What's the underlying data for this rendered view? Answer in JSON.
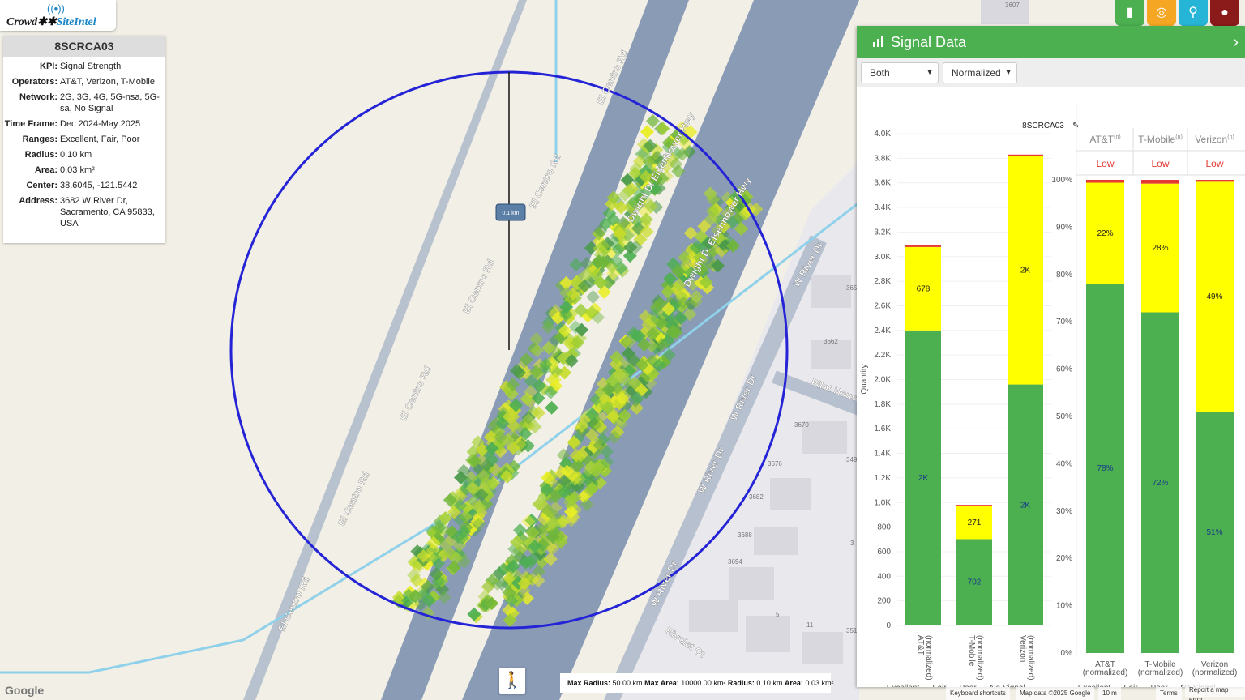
{
  "logo": {
    "text_a": "Crowd",
    "text_b": "SiteIntel"
  },
  "site_panel": {
    "title": "8SCRCA03",
    "rows": [
      {
        "k": "KPI:",
        "v": "Signal Strength"
      },
      {
        "k": "Operators:",
        "v": "AT&T, Verizon, T-Mobile"
      },
      {
        "k": "Network:",
        "v": "2G, 3G, 4G, 5G-nsa, 5G-sa, No Signal"
      },
      {
        "k": "Time Frame:",
        "v": "Dec 2024-May 2025"
      },
      {
        "k": "Ranges:",
        "v": "Excellent, Fair, Poor"
      },
      {
        "k": "Radius:",
        "v": "0.10 km"
      },
      {
        "k": "Area:",
        "v": "0.03 km²"
      },
      {
        "k": "Center:",
        "v": "38.6045, -121.5442"
      },
      {
        "k": "Address:",
        "v": "3682 W River Dr, Sacramento, CA 95833, USA"
      }
    ]
  },
  "map": {
    "radius_label": "0.1 km",
    "roads": [
      "El Centro Rd",
      "El Centro Rd",
      "El Centro Rd",
      "El Centro Rd",
      "El Centro Rd",
      "El Centro Rd",
      "Dwight D. Eisenhower Hwy",
      "Dwight D. Eisenhower Hwy",
      "W River Dr",
      "W River Dr",
      "W River Dr",
      "W River Dr",
      "Pilot House",
      "Rivulet Ct"
    ],
    "addresses": [
      "3607",
      "3662",
      "3670",
      "3676",
      "3682",
      "3688",
      "3694",
      "5",
      "11",
      "365",
      "349",
      "351",
      "3"
    ],
    "stats": {
      "max_radius_label": "Max Radius:",
      "max_radius": "50.00 km",
      "max_area_label": "Max Area:",
      "max_area": "10000.00 km²",
      "radius_label": "Radius:",
      "radius": "0.10 km",
      "area_label": "Area:",
      "area": "0.03 km²"
    },
    "attribution": {
      "google": "Google",
      "keyboard": "Keyboard shortcuts",
      "mapdata": "Map data ©2025 Google",
      "scale": "10 m",
      "terms": "Terms",
      "report": "Report a map error"
    }
  },
  "toolbar": {
    "buttons": [
      {
        "name": "signal-chart",
        "color": "#4caf50"
      },
      {
        "name": "target",
        "color": "#f5a623"
      },
      {
        "name": "location-pin",
        "color": "#26b5d6"
      },
      {
        "name": "globe",
        "color": "#8b1a1a"
      }
    ]
  },
  "signal_panel": {
    "title": "Signal Data",
    "filter_operator": "Both",
    "filter_mode": "Normalized",
    "site_label": "8SCRCA03"
  },
  "colors": {
    "excellent": "#4caf50",
    "fair": "#ffff00",
    "poor": "#e53935",
    "no_signal": "#bdbdbd",
    "circle": "#2424d6"
  },
  "chart_data": [
    {
      "type": "bar",
      "stacked": true,
      "title": "8SCRCA03",
      "ylabel": "Quantity",
      "ylim": [
        0,
        4000
      ],
      "yticks": [
        "0",
        "200",
        "400",
        "600",
        "800",
        "1.0K",
        "1.2K",
        "1.4K",
        "1.6K",
        "1.8K",
        "2.0K",
        "2.2K",
        "2.4K",
        "2.6K",
        "2.8K",
        "3.0K",
        "3.2K",
        "3.4K",
        "3.6K",
        "3.8K",
        "4.0K"
      ],
      "categories": [
        "AT&T (normalized)",
        "T-Mobile (normalized)",
        "Verizon (normalized)"
      ],
      "series": [
        {
          "name": "Excellent",
          "values": [
            2400,
            702,
            1960
          ],
          "labels": [
            "2K",
            "702",
            "2K"
          ]
        },
        {
          "name": "Fair",
          "values": [
            678,
            271,
            1860
          ],
          "labels": [
            "678",
            "271",
            "2K"
          ]
        },
        {
          "name": "Poor",
          "values": [
            18,
            8,
            10
          ],
          "labels": [
            "",
            "",
            ""
          ]
        },
        {
          "name": "No Signal",
          "values": [
            0,
            0,
            0
          ],
          "labels": [
            "",
            "",
            ""
          ]
        }
      ],
      "legend": [
        "Excellent",
        "Fair",
        "Poor",
        "No Signal"
      ]
    },
    {
      "type": "bar",
      "stacked": true,
      "ylim": [
        0,
        100
      ],
      "yticks": [
        "0%",
        "10%",
        "20%",
        "30%",
        "40%",
        "50%",
        "60%",
        "70%",
        "80%",
        "90%",
        "100%"
      ],
      "headers": [
        "AT&T",
        "T-Mobile",
        "Verizon"
      ],
      "header_sup": "(n)",
      "ratings": [
        "Low",
        "Low",
        "Low"
      ],
      "categories": [
        "AT&T (normalized)",
        "T-Mobile (normalized)",
        "Verizon (normalized)"
      ],
      "series": [
        {
          "name": "Excellent",
          "values": [
            78,
            72,
            51
          ],
          "labels": [
            "78%",
            "72%",
            "51%"
          ]
        },
        {
          "name": "Fair",
          "values": [
            21.4,
            27.2,
            48.6
          ],
          "labels": [
            "22%",
            "28%",
            "49%"
          ]
        },
        {
          "name": "Poor",
          "values": [
            0.6,
            0.8,
            0.4
          ],
          "labels": [
            "",
            "",
            ""
          ]
        },
        {
          "name": "No Signal",
          "values": [
            0,
            0,
            0
          ],
          "labels": [
            "",
            "",
            ""
          ]
        }
      ],
      "legend": [
        "Excellent",
        "Fair",
        "Poor",
        "No Signal"
      ]
    }
  ]
}
